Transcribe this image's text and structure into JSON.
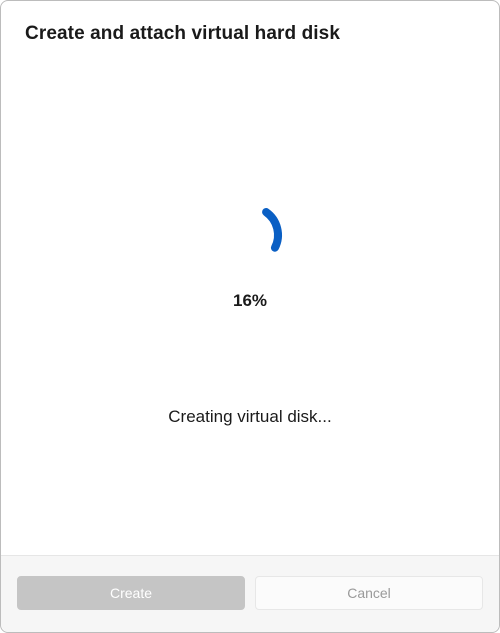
{
  "dialog": {
    "title": "Create and attach virtual hard disk"
  },
  "progress": {
    "percent_label": "16%",
    "percent_value": 16,
    "status_text": "Creating virtual disk..."
  },
  "footer": {
    "create_label": "Create",
    "cancel_label": "Cancel"
  },
  "colors": {
    "accent": "#0a5fc4"
  }
}
